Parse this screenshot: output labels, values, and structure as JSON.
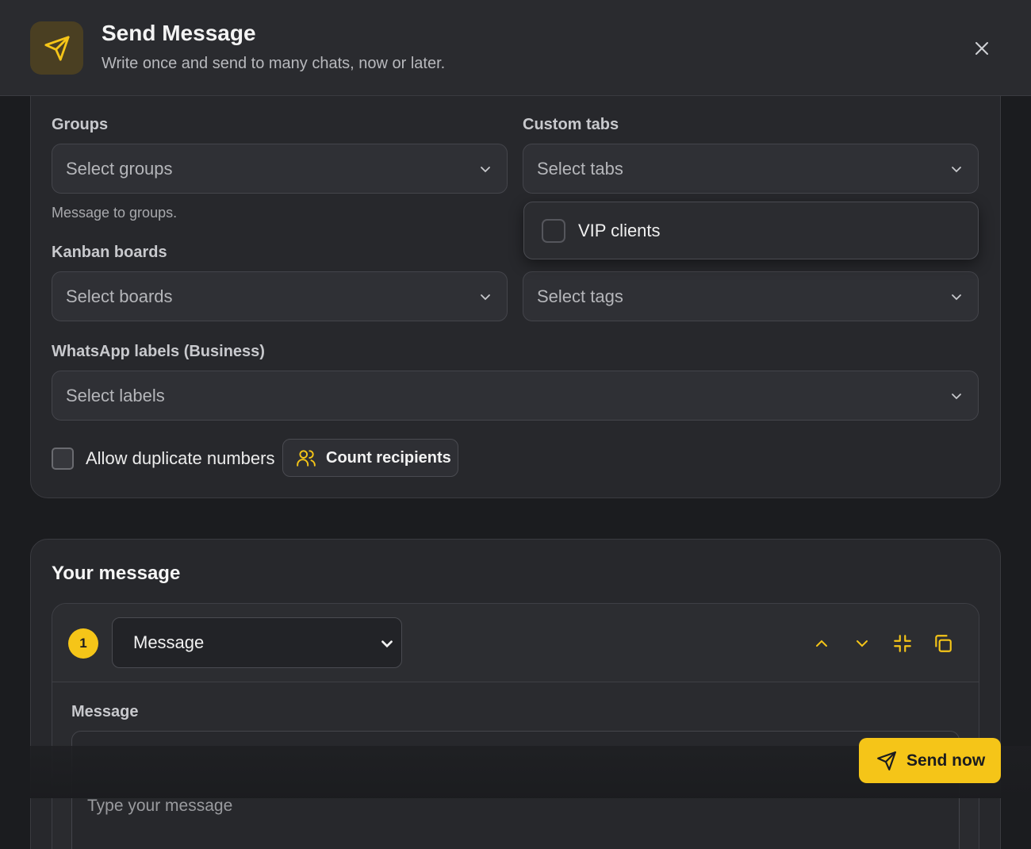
{
  "header": {
    "title": "Send Message",
    "subtitle": "Write once and send to many chats, now or later."
  },
  "recipients": {
    "groups": {
      "label": "Groups",
      "placeholder": "Select groups",
      "helper": "Message to groups."
    },
    "custom_tabs": {
      "label": "Custom tabs",
      "placeholder": "Select tabs"
    },
    "kanban": {
      "label": "Kanban boards",
      "placeholder": "Select boards"
    },
    "tags": {
      "placeholder": "Select tags"
    },
    "labels": {
      "label": "WhatsApp labels (Business)",
      "placeholder": "Select labels"
    },
    "custom_tabs_dropdown": {
      "options": [
        "VIP clients"
      ]
    },
    "allow_duplicates": {
      "label": "Allow duplicate numbers",
      "checked": false
    },
    "count_button": "Count recipients"
  },
  "message": {
    "title": "Your message",
    "step_number": "1",
    "type_selected": "Message",
    "field_label": "Message",
    "placeholder": "Type your message"
  },
  "actions": {
    "send_now": "Send now"
  },
  "colors": {
    "accent": "#f5c518",
    "background": "#1b1c1f",
    "card": "#27282c"
  }
}
